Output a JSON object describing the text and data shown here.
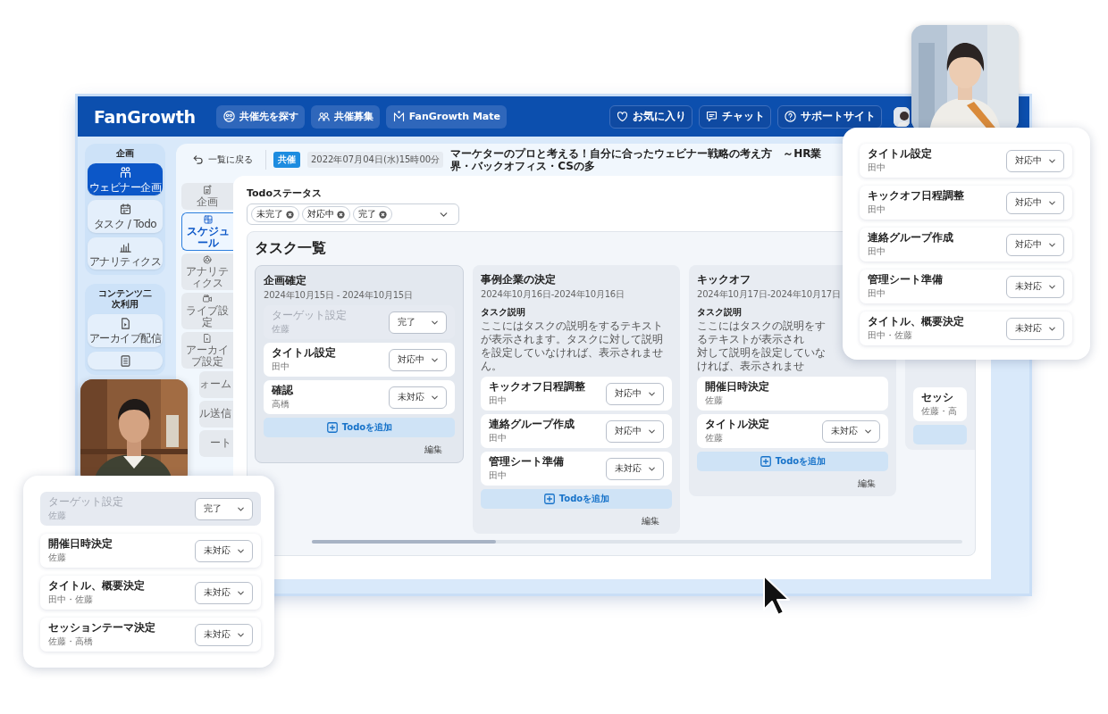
{
  "header": {
    "logo": "FanGrowth",
    "nav": [
      {
        "label": "共催先を探す"
      },
      {
        "label": "共催募集"
      },
      {
        "label": "FanGrowth Mate"
      }
    ],
    "actions": [
      {
        "label": "お気に入り"
      },
      {
        "label": "チャット"
      },
      {
        "label": "サポートサイト"
      }
    ]
  },
  "sidebar": {
    "sections": [
      {
        "title": "企画",
        "items": [
          {
            "label": "ウェビナー企画",
            "selected": true
          },
          {
            "label": "タスク / Todo",
            "selected": false
          },
          {
            "label": "アナリティクス",
            "selected": false
          }
        ]
      },
      {
        "title": "コンテンツ二次利用",
        "items": [
          {
            "label": "アーカイブ配信",
            "selected": false
          },
          {
            "selected": false
          }
        ]
      }
    ]
  },
  "event": {
    "back": "一覧に戻る",
    "badge": "共催",
    "date": "2022年07月04日(水)15時00分",
    "title": "マーケターのプロと考える！自分に合ったウェビナー戦略の考え方　～HR業界・バックオフィス・CSの多"
  },
  "subnav": [
    {
      "label": "企画",
      "selected": false
    },
    {
      "label": "スケジュール",
      "selected": true
    },
    {
      "label": "アナリティクス",
      "selected": false
    },
    {
      "label": "ライブ設定",
      "selected": false
    },
    {
      "label": "アーカイブ設定",
      "selected": false
    },
    {
      "label": "ォーム",
      "selected": false
    },
    {
      "label": "ル送信",
      "selected": false
    },
    {
      "label": "ート",
      "selected": false
    }
  ],
  "filter": {
    "label": "Todoステータス",
    "chips": [
      "未完了",
      "対応中",
      "完了"
    ]
  },
  "task_list": {
    "title": "タスク一覧",
    "columns": [
      {
        "title": "企画確定",
        "dates": "2024年10月15日 - 2024年10月15日",
        "tasks": [
          {
            "title": "ターゲット設定",
            "assignee": "佐藤",
            "status": "完了",
            "completed": true
          },
          {
            "title": "タイトル設定",
            "assignee": "田中",
            "status": "対応中",
            "completed": false
          },
          {
            "title": "確認",
            "assignee": "高橋",
            "status": "未対応",
            "completed": false
          }
        ],
        "add": "Todoを追加",
        "edit": "編集"
      },
      {
        "title": "事例企業の決定",
        "dates": "2024年10月16日-2024年10月16日",
        "description_label": "タスク説明",
        "description_lines": [
          "ここにはタスクの説明をするテキストが表示されます。タスクに対して説明を設定していなければ、表示されません。"
        ],
        "tasks": [
          {
            "title": "キックオフ日程調整",
            "assignee": "田中",
            "status": "対応中",
            "completed": false
          },
          {
            "title": "連絡グループ作成",
            "assignee": "田中",
            "status": "対応中",
            "completed": false
          },
          {
            "title": "管理シート準備",
            "assignee": "田中",
            "status": "未対応",
            "completed": false
          }
        ],
        "add": "Todoを追加",
        "edit": "編集"
      },
      {
        "title": "キックオフ",
        "dates": "2024年10月17日-2024年10月17日",
        "description_label": "タスク説明",
        "description_lines": [
          "ここにはタスクの説明をするテキストが表示され",
          "対して説明を設定していなければ、表示されませ"
        ],
        "tasks": [
          {
            "title": "開催日時決定",
            "assignee": "佐藤",
            "completed": false
          },
          {
            "title": "タイトル決定",
            "assignee": "佐藤",
            "status": "未対応",
            "completed": false
          }
        ],
        "add": "Todoを追加",
        "edit": "編集"
      },
      {
        "tasks": [
          {
            "title": "セッシ",
            "assignee": "佐藤・高",
            "completed": false
          }
        ]
      }
    ]
  },
  "cards": [
    {
      "tasks": [
        {
          "title": "タイトル設定",
          "assignee": "田中",
          "status": "対応中",
          "completed": false
        },
        {
          "title": "キックオフ日程調整",
          "assignee": "田中",
          "status": "対応中",
          "completed": false
        },
        {
          "title": "連絡グループ作成",
          "assignee": "田中",
          "status": "対応中",
          "completed": false
        },
        {
          "title": "管理シート準備",
          "assignee": "田中",
          "status": "未対応",
          "completed": false
        },
        {
          "title": "タイトル、概要決定",
          "assignee": "田中・佐藤",
          "status": "未対応",
          "completed": false
        }
      ]
    },
    {
      "tasks": [
        {
          "title": "ターゲット設定",
          "assignee": "佐藤",
          "status": "完了",
          "completed": true
        },
        {
          "title": "開催日時決定",
          "assignee": "佐藤",
          "status": "未対応",
          "completed": false
        },
        {
          "title": "タイトル、概要決定",
          "assignee": "田中・佐藤",
          "status": "未対応",
          "completed": false
        },
        {
          "title": "セッションテーマ決定",
          "assignee": "佐藤・高橋",
          "status": "未対応",
          "completed": false
        }
      ]
    }
  ]
}
